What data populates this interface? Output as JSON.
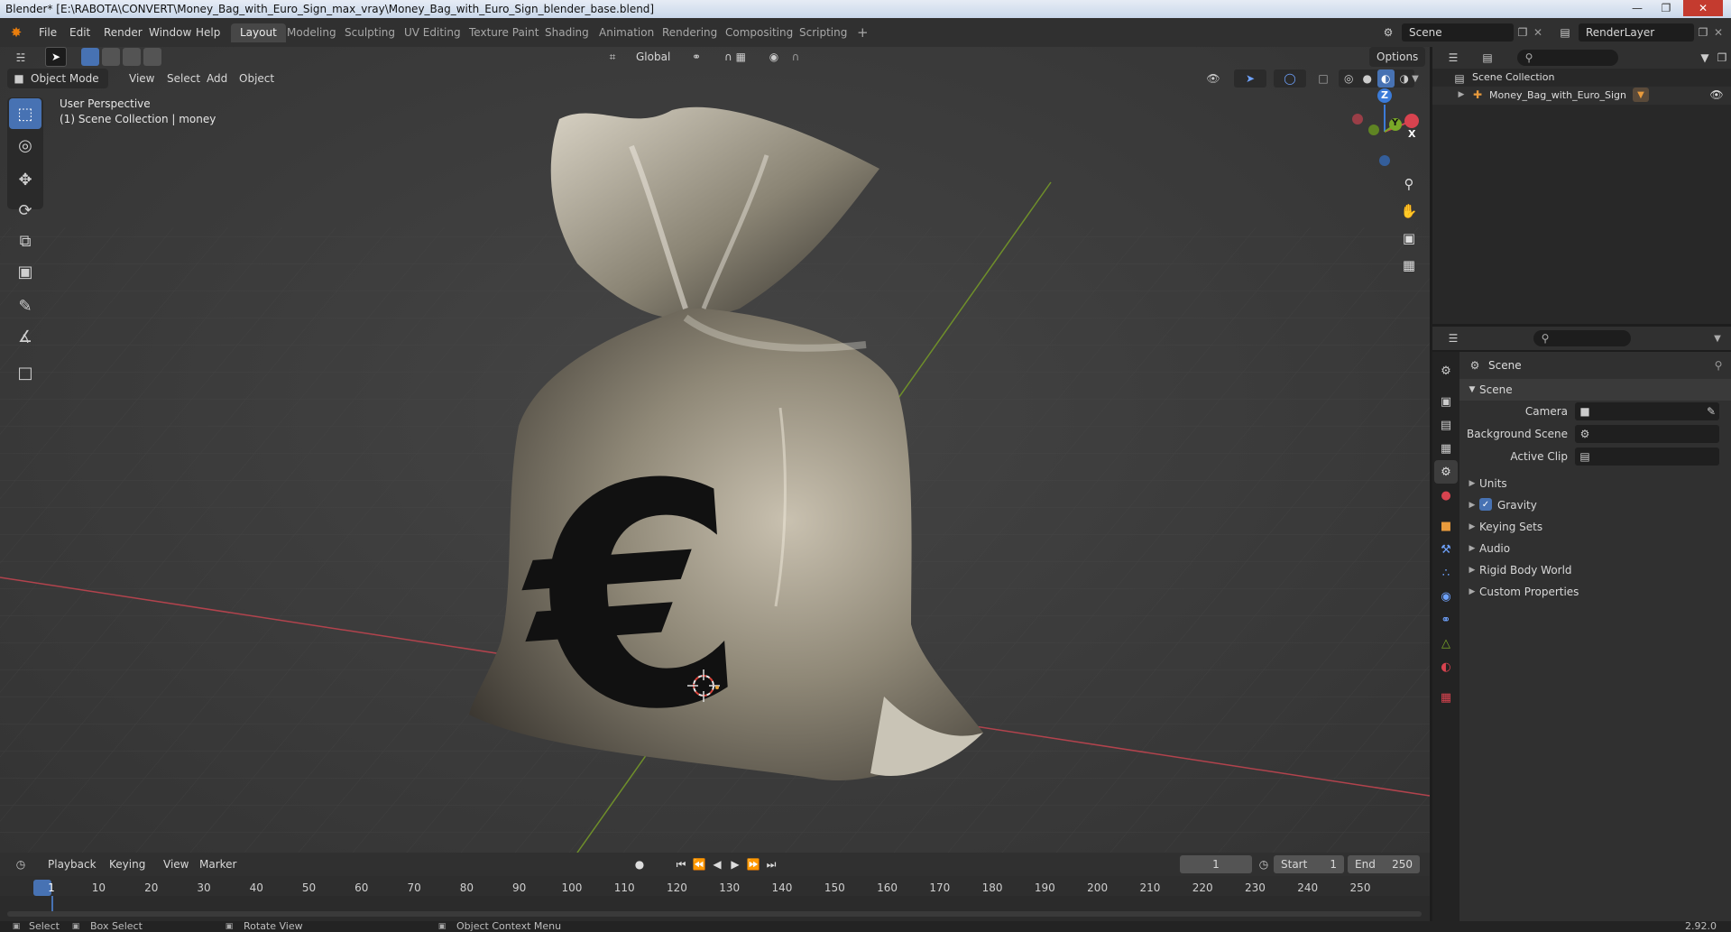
{
  "window": {
    "title": "Blender* [E:\\RABOTA\\CONVERT\\Money_Bag_with_Euro_Sign_max_vray\\Money_Bag_with_Euro_Sign_blender_base.blend]"
  },
  "menu": [
    "File",
    "Edit",
    "Render",
    "Window",
    "Help"
  ],
  "workspaces": [
    {
      "label": "Layout",
      "active": true
    },
    {
      "label": "Modeling"
    },
    {
      "label": "Sculpting"
    },
    {
      "label": "UV Editing"
    },
    {
      "label": "Texture Paint"
    },
    {
      "label": "Shading"
    },
    {
      "label": "Animation"
    },
    {
      "label": "Rendering"
    },
    {
      "label": "Compositing"
    },
    {
      "label": "Scripting"
    }
  ],
  "scene_field": "Scene",
  "render_layer_field": "RenderLayer",
  "viewport": {
    "transform_orientation": "Global",
    "options_label": "Options",
    "mode": "Object Mode",
    "menus": [
      "View",
      "Select",
      "Add",
      "Object"
    ],
    "overlay_line1": "User Perspective",
    "overlay_line2": "(1) Scene Collection | money",
    "gizmo": {
      "x": "X",
      "y": "Y",
      "z": "Z"
    }
  },
  "outliner": {
    "collection": "Scene Collection",
    "object": "Money_Bag_with_Euro_Sign"
  },
  "properties": {
    "context": "Scene",
    "panel": "Scene",
    "camera_label": "Camera",
    "background_scene_label": "Background Scene",
    "active_clip_label": "Active Clip",
    "sections": [
      "Units",
      "Gravity",
      "Keying Sets",
      "Audio",
      "Rigid Body World",
      "Custom Properties"
    ],
    "gravity_checked": true
  },
  "timeline": {
    "menus": [
      "Playback",
      "Keying",
      "View",
      "Marker"
    ],
    "current_frame": "1",
    "start_label": "Start",
    "start": "1",
    "end_label": "End",
    "end": "250",
    "ticks": [
      "1",
      "10",
      "20",
      "30",
      "40",
      "50",
      "60",
      "70",
      "80",
      "90",
      "100",
      "110",
      "120",
      "130",
      "140",
      "150",
      "160",
      "170",
      "180",
      "190",
      "200",
      "210",
      "220",
      "230",
      "240",
      "250"
    ]
  },
  "statusbar": {
    "select": "Select",
    "box_select": "Box Select",
    "rotate_view": "Rotate View",
    "context_menu": "Object Context Menu",
    "version": "2.92.0"
  },
  "colors": {
    "accent": "#4772b3",
    "x_axis": "#d8434f",
    "y_axis": "#7aa828",
    "z_axis": "#3b7bd8"
  }
}
